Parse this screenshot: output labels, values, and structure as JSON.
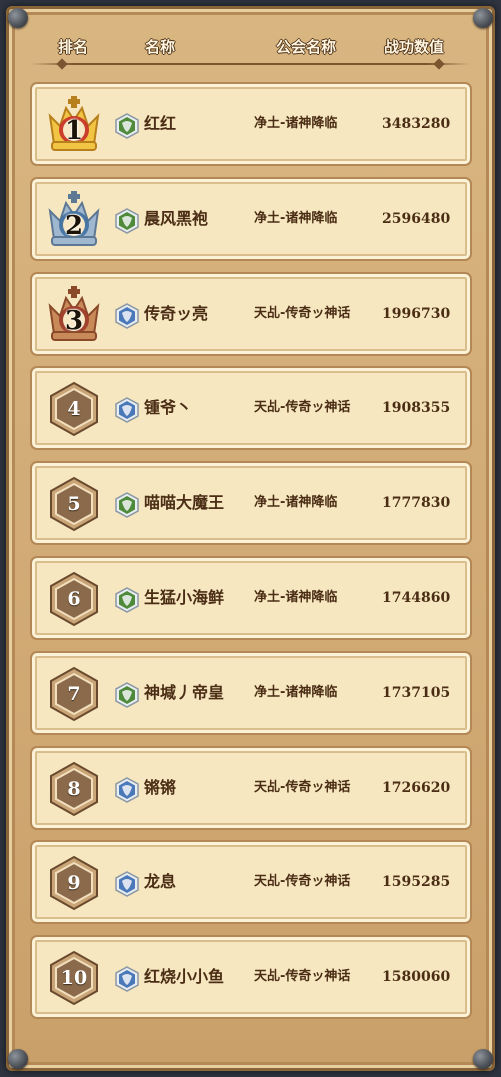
{
  "header": {
    "rank": "排名",
    "name": "名称",
    "guild": "公会名称",
    "score": "战功数值"
  },
  "colors": {
    "gold": "#e3a92a",
    "silver": "#7d9bb8",
    "bronze": "#b05a3a",
    "hex": "#8a6a4a",
    "green_camp": "#4f8a3b",
    "blue_camp": "#4a78b8"
  },
  "rows": [
    {
      "rank": "1",
      "badge": "gold-crown-icon",
      "camp": "green",
      "name": "红红",
      "guild": "净土-诸神降临",
      "score": "3483280"
    },
    {
      "rank": "2",
      "badge": "silver-crown-icon",
      "camp": "green",
      "name": "晨风黑袍",
      "guild": "净土-诸神降临",
      "score": "2596480"
    },
    {
      "rank": "3",
      "badge": "bronze-crown-icon",
      "camp": "blue",
      "name": "传奇ッ亮",
      "guild": "天乩-传奇ッ神话",
      "score": "1996730"
    },
    {
      "rank": "4",
      "badge": "hexagon-icon",
      "camp": "blue",
      "name": "锺爷丶",
      "guild": "天乩-传奇ッ神话",
      "score": "1908355"
    },
    {
      "rank": "5",
      "badge": "hexagon-icon",
      "camp": "green",
      "name": "喵喵大魔王",
      "guild": "净土-诸神降临",
      "score": "1777830"
    },
    {
      "rank": "6",
      "badge": "hexagon-icon",
      "camp": "green",
      "name": "生猛小海鲜",
      "guild": "净土-诸神降临",
      "score": "1744860"
    },
    {
      "rank": "7",
      "badge": "hexagon-icon",
      "camp": "green",
      "name": "神堿丿帝皇",
      "guild": "净土-诸神降临",
      "score": "1737105"
    },
    {
      "rank": "8",
      "badge": "hexagon-icon",
      "camp": "blue",
      "name": "锵锵",
      "guild": "天乩-传奇ッ神话",
      "score": "1726620"
    },
    {
      "rank": "9",
      "badge": "hexagon-icon",
      "camp": "blue",
      "name": "龙息",
      "guild": "天乩-传奇ッ神话",
      "score": "1595285"
    },
    {
      "rank": "10",
      "badge": "hexagon-icon",
      "camp": "blue",
      "name": "红烧小小鱼",
      "guild": "天乩-传奇ッ神话",
      "score": "1580060"
    }
  ]
}
